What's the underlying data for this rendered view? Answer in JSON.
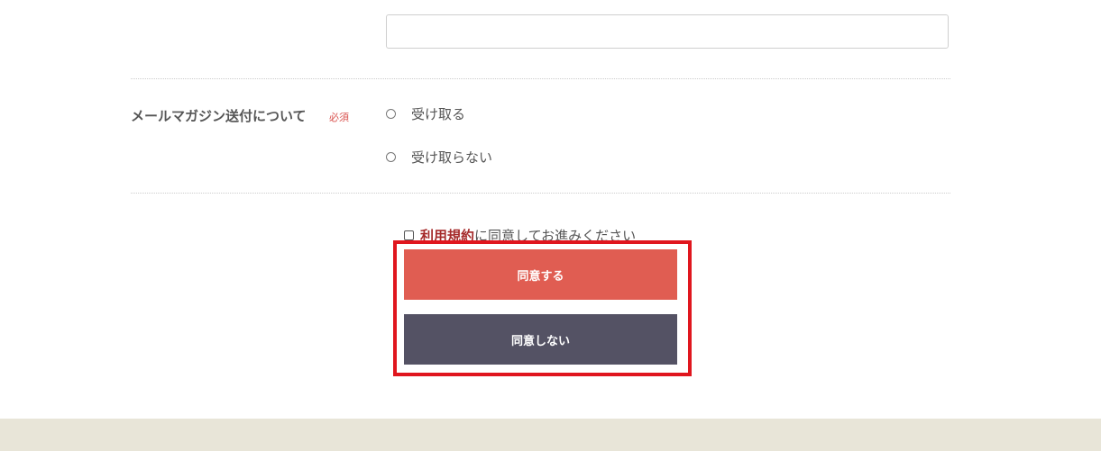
{
  "form": {
    "text_input": {
      "value": "",
      "placeholder": ""
    },
    "mail_magazine": {
      "label": "メールマガジン送付について",
      "required_badge": "必須",
      "options": [
        {
          "label": "受け取る",
          "selected": false
        },
        {
          "label": "受け取らない",
          "selected": false
        }
      ]
    },
    "agreement": {
      "checked": false,
      "terms_link": "利用規約",
      "text": "に同意してお進みください"
    },
    "buttons": {
      "agree": "同意する",
      "disagree": "同意しない"
    }
  },
  "colors": {
    "agree_button": "#e05d52",
    "disagree_button": "#545264",
    "highlight_border": "#e0161e",
    "required": "#d9534f",
    "terms_link": "#a52a2a",
    "footer": "#e8e5d8"
  }
}
